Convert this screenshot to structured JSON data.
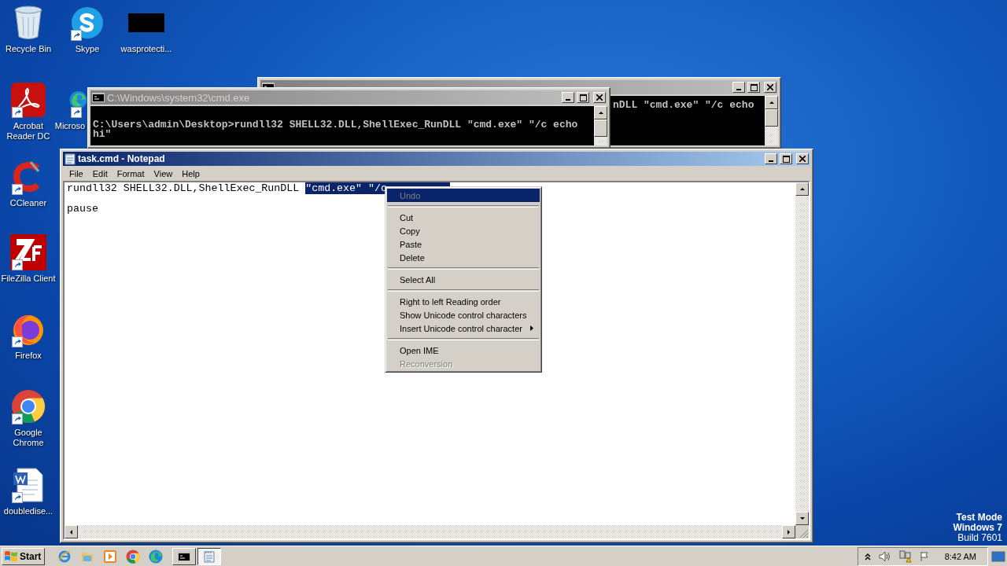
{
  "desktop_icons": [
    {
      "kind": "recycle",
      "label": "Recycle Bin"
    },
    {
      "kind": "skype",
      "label": "Skype"
    },
    {
      "kind": "blank",
      "label": "wasprotecti..."
    },
    {
      "kind": "acrobat",
      "label": "Acrobat Reader DC"
    },
    {
      "kind": "edge",
      "label": "Microso"
    },
    {
      "kind": "ccleaner",
      "label": "CCleaner"
    },
    {
      "kind": "filezilla",
      "label": "FileZilla Client"
    },
    {
      "kind": "firefox",
      "label": "Firefox"
    },
    {
      "kind": "chrome",
      "label": "Google Chrome"
    },
    {
      "kind": "word",
      "label": "doubledise..."
    }
  ],
  "cmd_back": {
    "active": false,
    "lines": [
      "nDLL \"cmd.exe\" \"/c echo"
    ]
  },
  "cmd_front": {
    "title": "C:\\Windows\\system32\\cmd.exe",
    "active": false,
    "lines": [
      "C:\\Users\\admin\\Desktop>rundll32 SHELL32.DLL,ShellExec_RunDLL \"cmd.exe\" \"/c echo",
      "hi\""
    ]
  },
  "notepad": {
    "title": "task.cmd - Notepad",
    "active": true,
    "menu": [
      "File",
      "Edit",
      "Format",
      "View",
      "Help"
    ],
    "lines": [
      {
        "text": "rundll32 SHELL32.DLL,ShellExec_RunDLL ",
        "selection": "\"cmd.exe\" \"/c"
      },
      {
        "text": "pause"
      }
    ]
  },
  "context_menu": [
    {
      "kind": "item",
      "label": "Undo",
      "disabled": true,
      "selected": true,
      "submenu": false
    },
    {
      "kind": "separator"
    },
    {
      "kind": "item",
      "label": "Cut",
      "disabled": false,
      "selected": false,
      "submenu": false
    },
    {
      "kind": "item",
      "label": "Copy",
      "disabled": false,
      "selected": false,
      "submenu": false
    },
    {
      "kind": "item",
      "label": "Paste",
      "disabled": false,
      "selected": false,
      "submenu": false
    },
    {
      "kind": "item",
      "label": "Delete",
      "disabled": false,
      "selected": false,
      "submenu": false
    },
    {
      "kind": "separator"
    },
    {
      "kind": "item",
      "label": "Select All",
      "disabled": false,
      "selected": false,
      "submenu": false
    },
    {
      "kind": "separator"
    },
    {
      "kind": "item",
      "label": "Right to left Reading order",
      "disabled": false,
      "selected": false,
      "submenu": false
    },
    {
      "kind": "item",
      "label": "Show Unicode control characters",
      "disabled": false,
      "selected": false,
      "submenu": false
    },
    {
      "kind": "item",
      "label": "Insert Unicode control character",
      "disabled": false,
      "selected": false,
      "submenu": true
    },
    {
      "kind": "separator"
    },
    {
      "kind": "item",
      "label": "Open IME",
      "disabled": false,
      "selected": false,
      "submenu": false
    },
    {
      "kind": "item",
      "label": "Reconversion",
      "disabled": true,
      "selected": false,
      "submenu": false
    }
  ],
  "desktop_notice": [
    "Test Mode",
    "Windows 7",
    "Build 7601"
  ],
  "taskbar": {
    "start_label": "Start",
    "quick_launch": [
      {
        "kind": "ie"
      },
      {
        "kind": "folder"
      },
      {
        "kind": "media"
      },
      {
        "kind": "chrome"
      },
      {
        "kind": "edge"
      }
    ],
    "tasks": [
      {
        "kind": "cmd",
        "selected": false
      },
      {
        "kind": "notepad",
        "selected": true
      }
    ],
    "tray": [
      {
        "kind": "arrow"
      },
      {
        "kind": "speaker"
      },
      {
        "kind": "network"
      },
      {
        "kind": "flag"
      }
    ],
    "clock": "8:42 AM"
  }
}
